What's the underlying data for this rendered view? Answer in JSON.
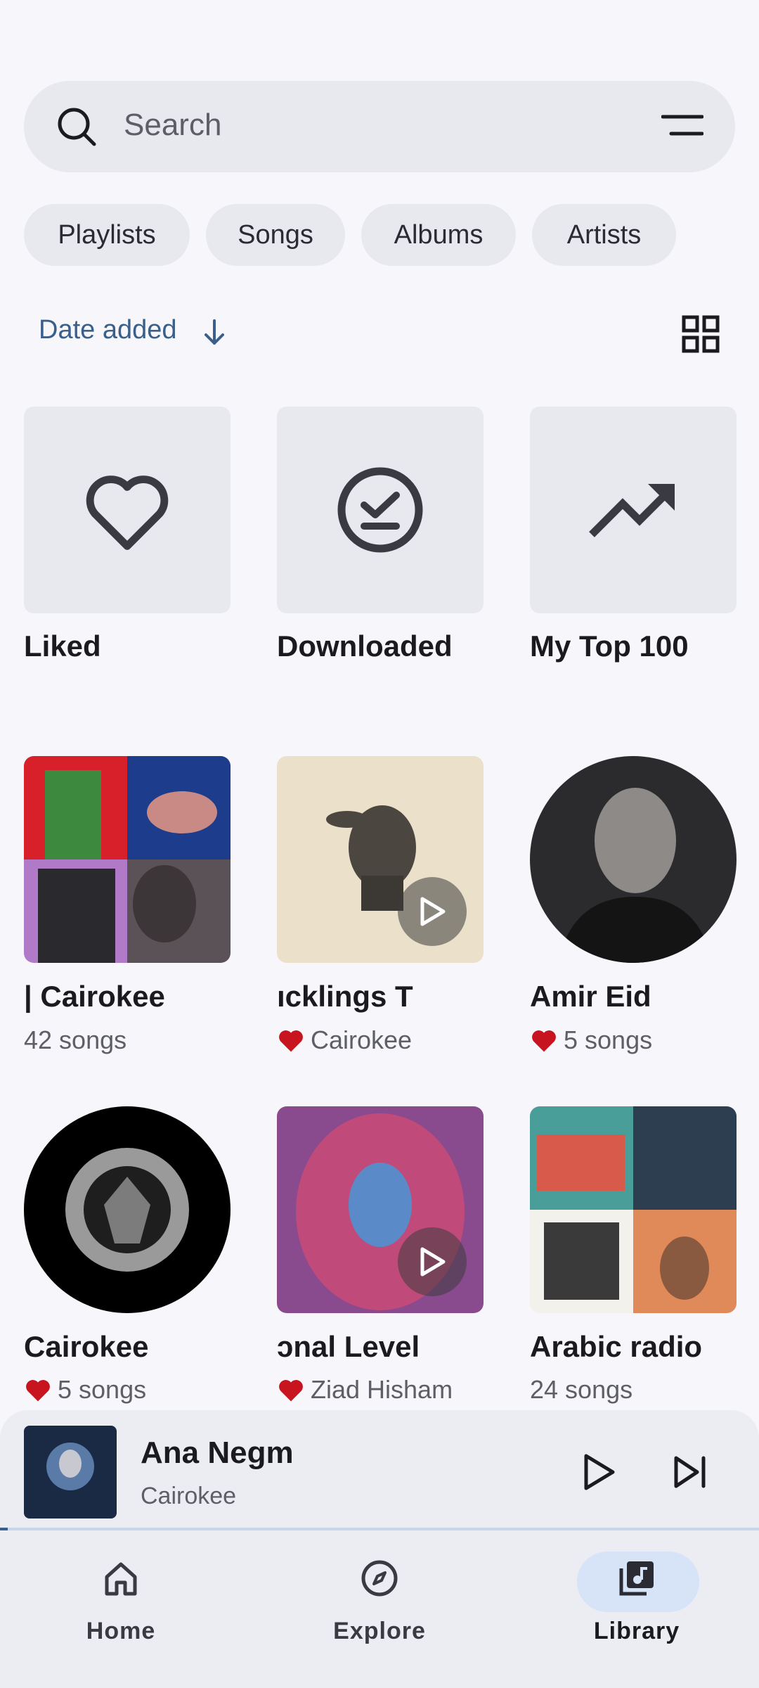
{
  "search": {
    "placeholder": "Search"
  },
  "chips": [
    "Playlists",
    "Songs",
    "Albums",
    "Artists"
  ],
  "sort": {
    "label": "Date added"
  },
  "library": [
    {
      "title": "Liked",
      "subtitle": "",
      "liked": false
    },
    {
      "title": "Downloaded",
      "subtitle": "",
      "liked": false
    },
    {
      "title": "My Top 100",
      "subtitle": "",
      "liked": false
    },
    {
      "title": "| Cairokee",
      "subtitle": "42 songs",
      "liked": false
    },
    {
      "title": "ıcklings        T",
      "subtitle": "Cairokee",
      "liked": true
    },
    {
      "title": "Amir Eid",
      "subtitle": "5 songs",
      "liked": true
    },
    {
      "title": "Cairokee",
      "subtitle": "5 songs",
      "liked": true
    },
    {
      "title": "ɔnal Level",
      "subtitle": "Ziad Hisham",
      "liked": true
    },
    {
      "title": "Arabic radio",
      "subtitle": "24 songs",
      "liked": false
    }
  ],
  "now_playing": {
    "title": "Ana Negm",
    "artist": "Cairokee",
    "progress": 0.01
  },
  "nav": [
    {
      "label": "Home",
      "selected": false
    },
    {
      "label": "Explore",
      "selected": false
    },
    {
      "label": "Library",
      "selected": true
    }
  ],
  "colors": {
    "accent": "#3a5f8a",
    "heart": "#c8141e",
    "background": "#f6f6fb",
    "surface": "#e8e9ee"
  }
}
